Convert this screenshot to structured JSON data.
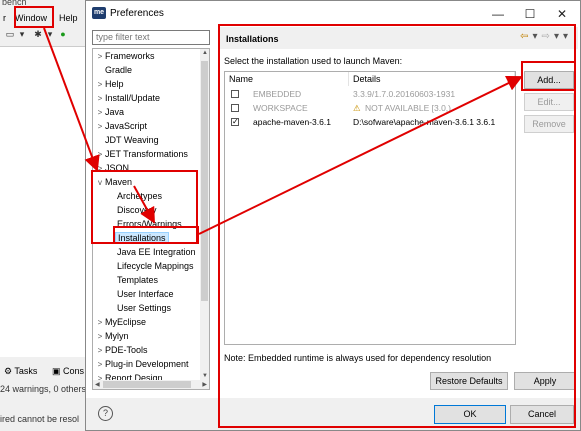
{
  "background": {
    "title_partial": "bench",
    "menu": [
      "r",
      "Window",
      "Help"
    ],
    "bottom_tabs": {
      "tasks": "Tasks",
      "console": "Cons"
    },
    "bottom_msg": "24 warnings, 0 others",
    "bottom_line": "ired cannot be resol"
  },
  "dialog": {
    "app_icon": "me",
    "title": "Preferences",
    "controls": {
      "minimize": "—",
      "maximize": "☐",
      "close": "✕"
    },
    "filter_placeholder": "type filter text",
    "tree": [
      {
        "label": "Frameworks",
        "twisty": ">"
      },
      {
        "label": "Gradle",
        "twisty": ""
      },
      {
        "label": "Help",
        "twisty": ">"
      },
      {
        "label": "Install/Update",
        "twisty": ">"
      },
      {
        "label": "Java",
        "twisty": ">"
      },
      {
        "label": "JavaScript",
        "twisty": ">"
      },
      {
        "label": "JDT Weaving",
        "twisty": ""
      },
      {
        "label": "JET Transformations",
        "twisty": ">"
      },
      {
        "label": "JSON",
        "twisty": ">"
      },
      {
        "label": "Maven",
        "twisty": "v"
      },
      {
        "label": "Archetypes",
        "twisty": ""
      },
      {
        "label": "Discovery",
        "twisty": ""
      },
      {
        "label": "Errors/Warnings",
        "twisty": ""
      },
      {
        "label": "Installations",
        "twisty": ""
      },
      {
        "label": "Java EE Integration",
        "twisty": ""
      },
      {
        "label": "Lifecycle Mappings",
        "twisty": ""
      },
      {
        "label": "Templates",
        "twisty": ""
      },
      {
        "label": "User Interface",
        "twisty": ""
      },
      {
        "label": "User Settings",
        "twisty": ""
      },
      {
        "label": "MyEclipse",
        "twisty": ">"
      },
      {
        "label": "Mylyn",
        "twisty": ">"
      },
      {
        "label": "PDE-Tools",
        "twisty": ">"
      },
      {
        "label": "Plug-in Development",
        "twisty": ">"
      },
      {
        "label": "Report Design",
        "twisty": ">"
      }
    ],
    "page_title": "Installations",
    "nav_icons": [
      "⇦",
      "▾",
      "⇨",
      "▾",
      "▾"
    ],
    "instruction": "Select the installation used to launch Maven:",
    "columns": {
      "name": "Name",
      "details": "Details"
    },
    "rows": [
      {
        "checked": false,
        "name": "EMBEDDED",
        "details": "3.3.9/1.7.0.20160603-1931",
        "warning": ""
      },
      {
        "checked": false,
        "name": "WORKSPACE",
        "details": "NOT AVAILABLE [3.0,)",
        "warning": "⚠"
      },
      {
        "checked": true,
        "name": "apache-maven-3.6.1",
        "details": "D:\\sofware\\apache-maven-3.6.1 3.6.1",
        "warning": ""
      }
    ],
    "buttons": {
      "add": "Add...",
      "edit": "Edit...",
      "remove": "Remove",
      "restore_defaults": "Restore Defaults",
      "apply": "Apply",
      "ok": "OK",
      "cancel": "Cancel"
    },
    "note": "Note: Embedded runtime is always used for dependency resolution",
    "help": "?"
  },
  "colors": {
    "annotation": "#e00000",
    "selection": "#cce8ff",
    "accent": "#0078d7"
  }
}
